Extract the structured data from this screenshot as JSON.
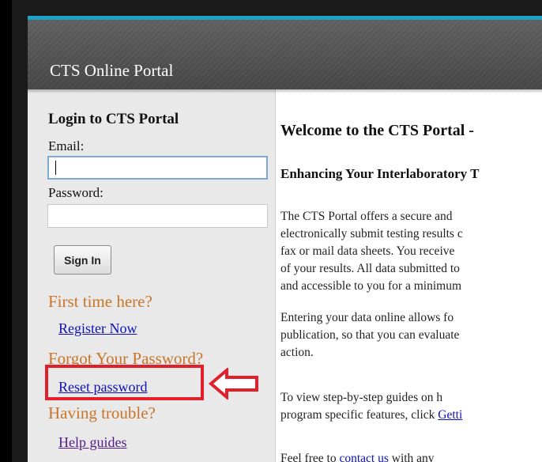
{
  "header": {
    "title": "CTS Online Portal"
  },
  "login": {
    "title": "Login to CTS Portal",
    "email_label": "Email:",
    "email_value": "",
    "password_label": "Password:",
    "password_value": "",
    "sign_in_label": "Sign In"
  },
  "sidebar": {
    "first_time_heading": "First time here?",
    "register_link": "Register Now",
    "forgot_heading": "Forgot Your Password?",
    "reset_link": "Reset password",
    "trouble_heading": "Having trouble?",
    "help_link": "Help guides"
  },
  "annotation": {
    "color": "#e0202a",
    "icon": "left-arrow-icon"
  },
  "content": {
    "heading": "Welcome to the CTS Portal -",
    "subheading": "Enhancing Your Interlaboratory T",
    "para1": [
      "The CTS Portal offers a secure and",
      "electronically submit testing results c",
      "fax or mail data sheets. You receive",
      "of your results. All data submitted to",
      "and accessible to you for a minimum"
    ],
    "para2": [
      "Entering your data online allows fo",
      "publication, so that you can evaluate",
      "action."
    ],
    "para3_line1": "To view step-by-step guides on h",
    "para3_line2_prefix": "program specific features, click ",
    "para3_line2_link": "Getti",
    "para4_prefix": "Feel free to ",
    "para4_link": "contact us",
    "para4_suffix": " with any"
  },
  "colors": {
    "accent": "#1aa3c4",
    "header_bg": "#555555",
    "sidebar_heading": "#c9752a",
    "link": "#1010b8",
    "visited_link": "#551a8b"
  }
}
